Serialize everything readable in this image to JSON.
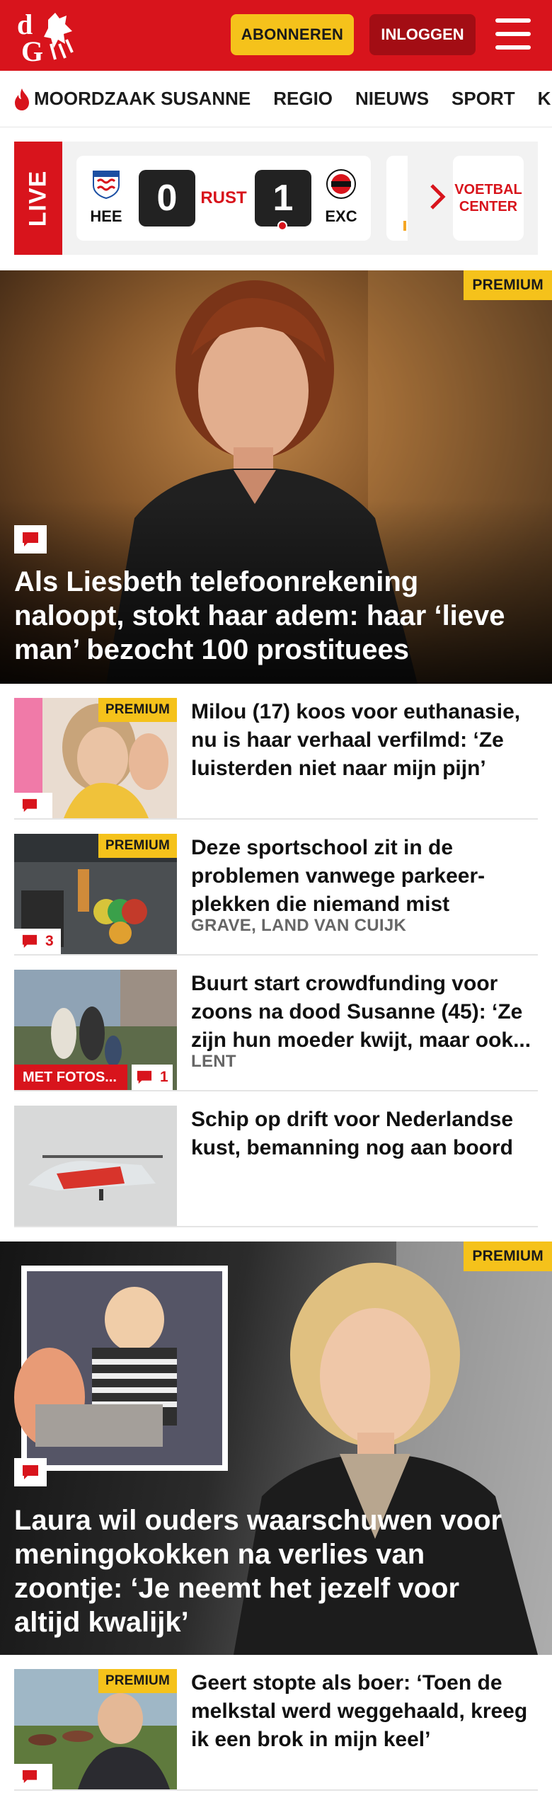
{
  "header": {
    "logo_text": "dG",
    "subscribe_label": "ABONNEREN",
    "login_label": "INLOGGEN",
    "brand_color": "#d8141c"
  },
  "nav": {
    "items": [
      {
        "label": "MOORDZAAK SUSANNE",
        "icon": "flame-icon"
      },
      {
        "label": "REGIO"
      },
      {
        "label": "NIEUWS"
      },
      {
        "label": "SPORT"
      },
      {
        "label": "KIJK"
      }
    ]
  },
  "live": {
    "label": "LIVE",
    "match": {
      "home": "HEE",
      "away": "EXC",
      "home_score": "0",
      "away_score": "1",
      "status": "RUST"
    },
    "voetbal_center": "VOETBAL CENTER"
  },
  "hero": {
    "badge": "PREMIUM",
    "title": "Als Liesbeth telefoonrekening naloopt, stokt haar adem: haar ‘lieve man’ bezocht 100 prostituees"
  },
  "articles": [
    {
      "title": "Milou (17) koos voor euthanasie, nu is haar verhaal verfilmd: ‘Ze luisterden niet naar mijn pijn’",
      "badge": "PREMIUM",
      "comments": "",
      "location": ""
    },
    {
      "title": "Deze sportschool zit in de problemen vanwege parkeer-plekken die niemand mist",
      "badge": "PREMIUM",
      "comments": "3",
      "location": "GRAVE, LAND VAN CUIJK"
    },
    {
      "title": "Buurt start crowdfunding voor zoons na dood Susanne (45): ‘Ze zijn hun moeder kwijt, maar ook...",
      "badge": "",
      "comments": "1",
      "media_label": "MET FOTOS...",
      "location": "LENT"
    },
    {
      "title": "Schip op drift voor Nederlandse kust, bemanning nog aan boord",
      "badge": "",
      "comments": "",
      "location": ""
    }
  ],
  "hero2": {
    "badge": "PREMIUM",
    "title": "Laura wil ouders waarschuwen voor meningokokken na verlies van zoontje: ‘Je neemt het jezelf voor altijd kwalijk’"
  },
  "articles2": [
    {
      "title": "Geert stopte als boer: ‘Toen de melkstal werd weggehaald, kreeg ik een brok in mijn keel’",
      "badge": "PREMIUM"
    }
  ]
}
